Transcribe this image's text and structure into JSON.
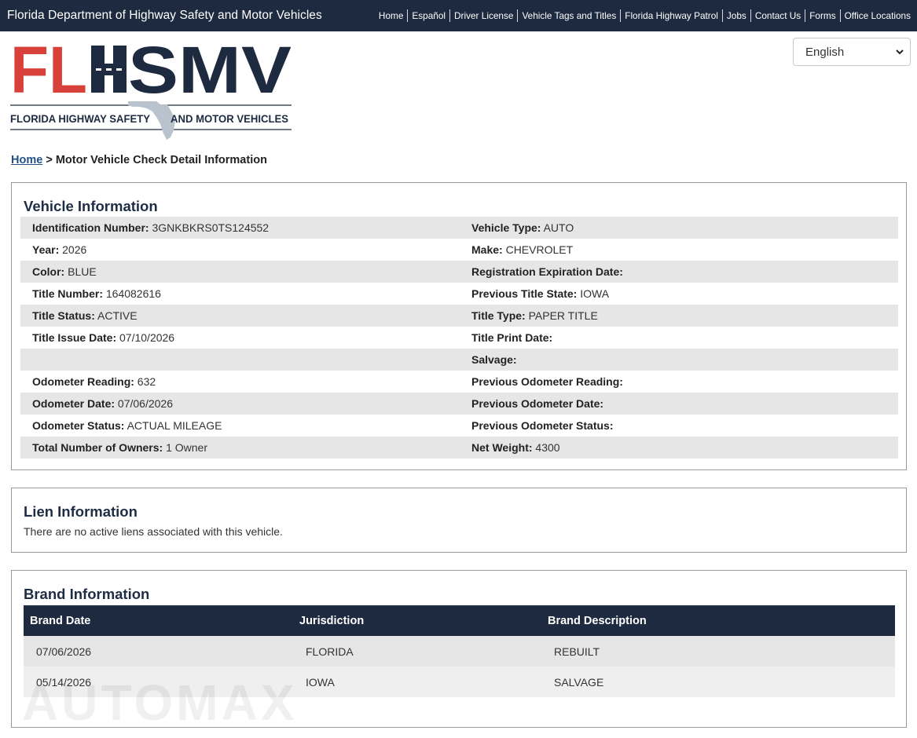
{
  "topbar": {
    "agency": "Florida Department of Highway Safety and Motor Vehicles",
    "nav": [
      "Home",
      "Español",
      "Driver License",
      "Vehicle Tags and Titles",
      "Florida Highway Patrol",
      "Jobs",
      "Contact Us",
      "Forms",
      "Office Locations"
    ]
  },
  "logo": {
    "letters_left": "FL",
    "letters_right": "SMV",
    "tagline_left": "FLORIDA HIGHWAY SAFETY",
    "tagline_right": "AND MOTOR VEHICLES"
  },
  "language": {
    "selected": "English"
  },
  "breadcrumb": {
    "home": "Home",
    "separator": ">",
    "current": "Motor Vehicle Check Detail Information"
  },
  "vehicle": {
    "title": "Vehicle Information",
    "rows": [
      [
        {
          "label": "Identification Number:",
          "value": "3GNKBKRS0TS124552"
        },
        {
          "label": "Vehicle Type:",
          "value": "AUTO"
        }
      ],
      [
        {
          "label": "Year:",
          "value": "2026"
        },
        {
          "label": "Make:",
          "value": "CHEVROLET"
        }
      ],
      [
        {
          "label": "Color:",
          "value": "BLUE"
        },
        {
          "label": "Registration Expiration Date:",
          "value": ""
        }
      ],
      [
        {
          "label": "Title Number:",
          "value": "164082616"
        },
        {
          "label": "Previous Title State:",
          "value": "IOWA"
        }
      ],
      [
        {
          "label": "Title Status:",
          "value": "ACTIVE"
        },
        {
          "label": "Title Type:",
          "value": "PAPER TITLE"
        }
      ],
      [
        {
          "label": "Title Issue Date:",
          "value": "07/10/2026"
        },
        {
          "label": "Title Print Date:",
          "value": ""
        }
      ],
      [
        {
          "label": "",
          "value": ""
        },
        {
          "label": "Salvage:",
          "value": ""
        }
      ],
      [
        {
          "label": "Odometer Reading:",
          "value": "632"
        },
        {
          "label": "Previous Odometer Reading:",
          "value": ""
        }
      ],
      [
        {
          "label": "Odometer Date:",
          "value": "07/06/2026"
        },
        {
          "label": "Previous Odometer Date:",
          "value": ""
        }
      ],
      [
        {
          "label": "Odometer Status:",
          "value": "ACTUAL MILEAGE"
        },
        {
          "label": "Previous Odometer Status:",
          "value": ""
        }
      ],
      [
        {
          "label": "Total Number of Owners:",
          "value": "1 Owner"
        },
        {
          "label": "Net Weight:",
          "value": "4300"
        }
      ]
    ]
  },
  "lien": {
    "title": "Lien Information",
    "message": "There are no active liens associated with this vehicle."
  },
  "brand": {
    "title": "Brand Information",
    "headers": [
      "Brand Date",
      "Jurisdiction",
      "Brand Description"
    ],
    "rows": [
      [
        "07/06/2026",
        "FLORIDA",
        "REBUILT"
      ],
      [
        "05/14/2026",
        "IOWA",
        "SALVAGE"
      ]
    ]
  },
  "watermark": "AUTOMAX",
  "colors": {
    "navy": "#1d2a3f",
    "red": "#d8413a",
    "link": "#1f4f86",
    "shade": "#e6e6e6"
  }
}
